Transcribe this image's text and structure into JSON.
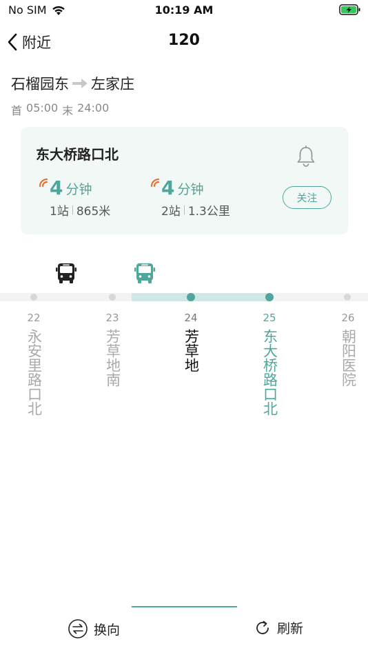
{
  "status_bar": {
    "carrier": "No SIM",
    "time": "10:19 AM",
    "icons": {
      "wifi": "wifi-icon",
      "battery": "battery-charging-icon"
    },
    "battery_color": "#34c759"
  },
  "nav": {
    "back_label": "附近",
    "title": "120",
    "back_icon": "chevron-left-icon"
  },
  "route": {
    "from": "石榴园东",
    "to": "左家庄",
    "arrow_icon": "arrow-right-icon"
  },
  "schedule": {
    "first_label": "首",
    "first_time": "05:00",
    "last_label": "末",
    "last_time": "24:00"
  },
  "card": {
    "station": "东大桥路口北",
    "bell_icon": "bell-icon",
    "etas": [
      {
        "minutes": "4",
        "unit": "分钟",
        "stops": "1站",
        "distance": "865米"
      },
      {
        "minutes": "4",
        "unit": "分钟",
        "stops": "2站",
        "distance": "1.3公里"
      }
    ],
    "follow_label": "关注"
  },
  "stops": [
    {
      "num": "22",
      "name": "永安里路口北",
      "state": "passed"
    },
    {
      "num": "23",
      "name": "芳草地南",
      "state": "passed"
    },
    {
      "num": "24",
      "name": "芳草地",
      "state": "current"
    },
    {
      "num": "25",
      "name": "东大桥路口北",
      "state": "selected"
    },
    {
      "num": "26",
      "name": "朝阳医院",
      "state": "upcoming"
    }
  ],
  "buses": [
    {
      "icon": "bus-icon",
      "color": "#222222"
    },
    {
      "icon": "bus-icon",
      "color": "#4ea79a"
    }
  ],
  "bottom": {
    "reverse_label": "换向",
    "reverse_icon": "swap-icon",
    "refresh_label": "刷新",
    "refresh_icon": "refresh-icon"
  },
  "colors": {
    "accent": "#4ea79a",
    "signal": "#e8703a",
    "card_bg": "#f1f8f6"
  }
}
